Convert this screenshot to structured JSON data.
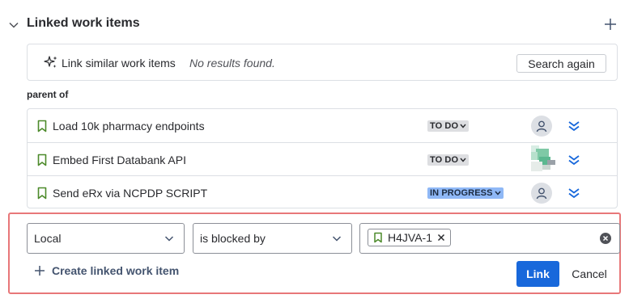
{
  "section": {
    "title": "Linked work items",
    "collapse_icon": "chevron-down-icon",
    "add_icon": "plus-icon"
  },
  "similar": {
    "icon": "sparkle-icon",
    "label": "Link similar work items",
    "status": "No results found.",
    "search_again": "Search again"
  },
  "group": {
    "label": "parent of",
    "items": [
      {
        "summary": "Load 10k pharmacy endpoints",
        "status": "TO DO",
        "status_color": "#dddee1",
        "assignee": "unassigned",
        "icon": "story-bookmark-icon"
      },
      {
        "summary": "Embed First Databank API",
        "status": "TO DO",
        "status_color": "#dddee1",
        "assignee": "avatar-image",
        "icon": "story-bookmark-icon"
      },
      {
        "summary": "Send eRx via NCPDP SCRIPT",
        "status": "IN PROGRESS",
        "status_color": "#8fb8f6",
        "assignee": "unassigned",
        "icon": "story-bookmark-icon"
      }
    ]
  },
  "link_form": {
    "scope": "Local",
    "link_type": "is blocked by",
    "selected_tag": "H4JVA-1",
    "create_label": "Create linked work item",
    "link_button": "Link",
    "cancel_button": "Cancel",
    "highlight_color": "#e87779",
    "primary_color": "#1868db"
  }
}
